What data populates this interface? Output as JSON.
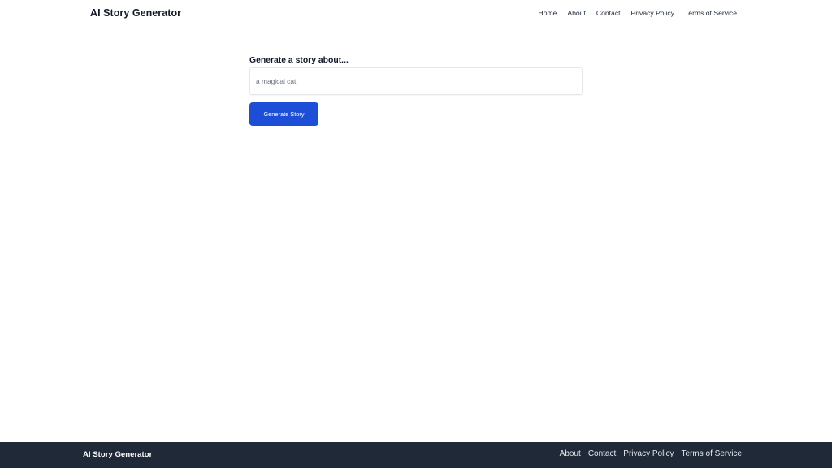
{
  "header": {
    "brand": "AI Story Generator",
    "nav": [
      "Home",
      "About",
      "Contact",
      "Privacy Policy",
      "Terms of Service"
    ]
  },
  "form": {
    "label": "Generate a story about...",
    "input_placeholder": "a magical cat",
    "input_value": "",
    "button_label": "Generate Story"
  },
  "footer": {
    "brand": "AI Story Generator",
    "nav": [
      "About",
      "Contact",
      "Privacy Policy",
      "Terms of Service"
    ]
  },
  "colors": {
    "accent": "#1d4ed8",
    "footer_bg": "#1f2937",
    "page_bg": "#ffffff"
  }
}
